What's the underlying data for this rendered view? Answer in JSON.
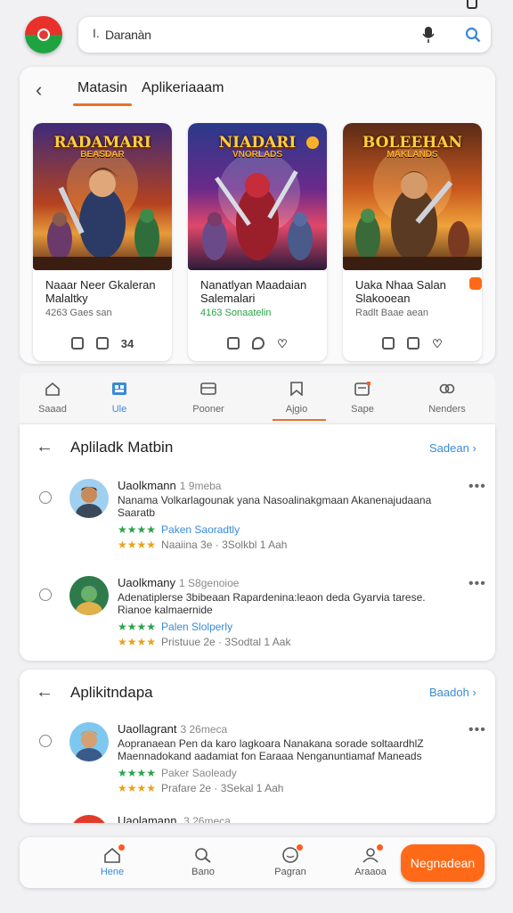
{
  "search": {
    "value": "Daranàn"
  },
  "recommended": {
    "tabs": [
      {
        "label": "Matasin"
      },
      {
        "label": "Aplikeriaaam"
      }
    ],
    "games": [
      {
        "art_title": "RADAMARI",
        "art_subtitle": "BEASDAR",
        "name": "Naaar Neer Gkaleran Malaltky",
        "meta": "4263 Gaes san",
        "icon_label": "34"
      },
      {
        "art_title": "NIADARI",
        "art_subtitle": "VNORLADS",
        "name": "Nanatlyan Maadaian Salemalari",
        "meta": "4163 Sonaatelin"
      },
      {
        "art_title": "BOLEEHAN",
        "art_subtitle": "MAKLANDS",
        "name": "Uaka Nhaa Salan Slakooean",
        "meta": "Radlt Baae aean"
      }
    ]
  },
  "categories": [
    {
      "label": "Saaad",
      "icon": "home-outline-icon"
    },
    {
      "label": "Ule",
      "icon": "grid-app-icon"
    },
    {
      "label": "Pooner",
      "icon": "card-icon"
    },
    {
      "label": "Ajgio",
      "icon": "bookmark-icon"
    },
    {
      "label": "Sape",
      "icon": "calendar-badge-icon"
    },
    {
      "label": "Nenders",
      "icon": "chain-icon"
    }
  ],
  "section1": {
    "title": "Apliladk Matbin",
    "link": "Sadean",
    "items": [
      {
        "name": "Uaolkmann",
        "time": "1 9meba",
        "desc": "Nanama Volkarlagounak yana Nasoalinakgmaan Akanenajudaana Saaratb",
        "stars": "★★★★",
        "rating_text": "Paken Saoradtly",
        "stars2": "★★★★",
        "stats": "Naaiina 3e  · 3Solkbl 1 Aah"
      },
      {
        "name": "Uaolkmany",
        "time": "1 S8genoioe",
        "desc": "Adenatiplerse 3bibeaan Rapardenina:leaon deda Gyarvia tarese. Rianoe kalmaernide",
        "stars": "★★★★",
        "rating_text": "Palen Slolperly",
        "stars2": "★★★★",
        "stats": "Pristuue 2e  · 3Sodtal 1 Aak"
      }
    ]
  },
  "section2": {
    "title": "Aplikitndapa",
    "link": "Baadoh",
    "items": [
      {
        "name": "Uaollagrant",
        "time": "3 26meca",
        "desc": "Aopranaean Pen da karo lagkoara Nanakana sorade soltaardhlZ Maennadokand aadamiat fon Earaaa Nenganuntiamaf Maneads",
        "stars": "★★★★",
        "rating_text": "Paker Saoleady",
        "stars2": "★★★★",
        "stats": "Prafare 2e  · 3Sekal 1 Aah"
      }
    ],
    "partial_name": "Uaolamann",
    "partial_time": "3 26meca"
  },
  "bottom_nav": [
    {
      "label": "Hene",
      "icon": "home-icon"
    },
    {
      "label": "Bano",
      "icon": "search-icon"
    },
    {
      "label": "Pagran",
      "icon": "chat-icon"
    },
    {
      "label": "Araaoa",
      "icon": "person-icon"
    }
  ],
  "cta": {
    "label": "Negnadean"
  },
  "colors": {
    "accent": "#ff6a18",
    "link": "#3a8ad8",
    "green": "#2aa34a",
    "star": "#e9a21c"
  }
}
